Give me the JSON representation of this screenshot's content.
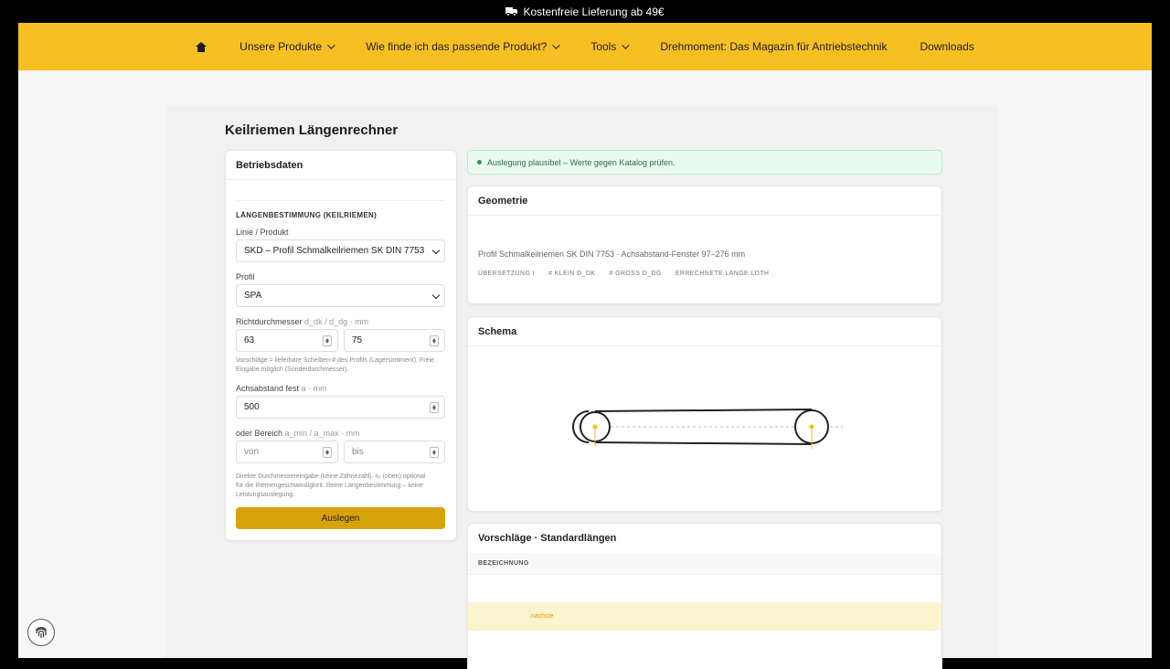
{
  "topbar": {
    "text": "Kostenfreie Lieferung ab 49€",
    "icon": "truck-icon"
  },
  "nav": {
    "home_icon": "home-icon",
    "items": [
      {
        "label": "Unsere Produkte",
        "dropdown": true
      },
      {
        "label": "Wie finde ich das passende Produkt?",
        "dropdown": true
      },
      {
        "label": "Tools",
        "dropdown": true
      },
      {
        "label": "Drehmoment: Das Magazin für Antriebstechnik",
        "dropdown": false
      },
      {
        "label": "Downloads",
        "dropdown": false
      }
    ]
  },
  "page": {
    "title": "Keilriemen Längenrechner"
  },
  "form": {
    "card_title": "Betriebsdaten",
    "section": "LÄNGENBESTIMMUNG (KEILRIEMEN)",
    "product_label": "Linie / Produkt",
    "product_value": "SKD – Profil Schmalkeilriemen SK DIN 7753",
    "profile_label": "Profil",
    "profile_value": "SPA",
    "diam_label": "Richtdurchmesser",
    "diam_unit": "d_dk / d_dg · mm",
    "d_dk": "63",
    "d_dg": "75",
    "diam_hint": "Vorschläge = lieferbare Scheiben-# des Profils (Lagersortiment). Freie Eingabe möglich (Sonderdurchmesser).",
    "axis_label": "Achsabstand fest",
    "axis_unit": "a · mm",
    "axis_value": "500",
    "range_label": "oder Bereich",
    "range_unit": "a_min / a_max · mm",
    "range_min_placeholder": "von",
    "range_max_placeholder": "bis",
    "footer_hint": "Direkte Durchmessereingabe (keine Zähnezahl). n₁ (oben) optional für die Riemengeschwindigkeit. Reine Längenbestimmung – keine Leistungsauslegung.",
    "submit_label": "Auslegen"
  },
  "status": {
    "text": "Auslegung plausibel – Werte gegen Katalog prüfen.",
    "color": "#2c9a53"
  },
  "geometry": {
    "title": "Geometrie",
    "description": "Profil Schmalkeilriemen SK DIN 7753 · Achsabstand-Fenster 97–276 mm",
    "tags": [
      "ÜBERSETZUNG I",
      "# KLEIN D_DK",
      "# GROSS D_DG",
      "ERRECHNETE LÄNGE LDTH"
    ]
  },
  "schema": {
    "title": "Schema",
    "accent": "#e8c11c"
  },
  "suggestions": {
    "title": "Vorschläge · Standardlängen",
    "column": "BEZEICHNUNG",
    "highlight_text": "nächste"
  },
  "colors": {
    "brand": "#f8bf22",
    "button": "#d8a20a"
  }
}
